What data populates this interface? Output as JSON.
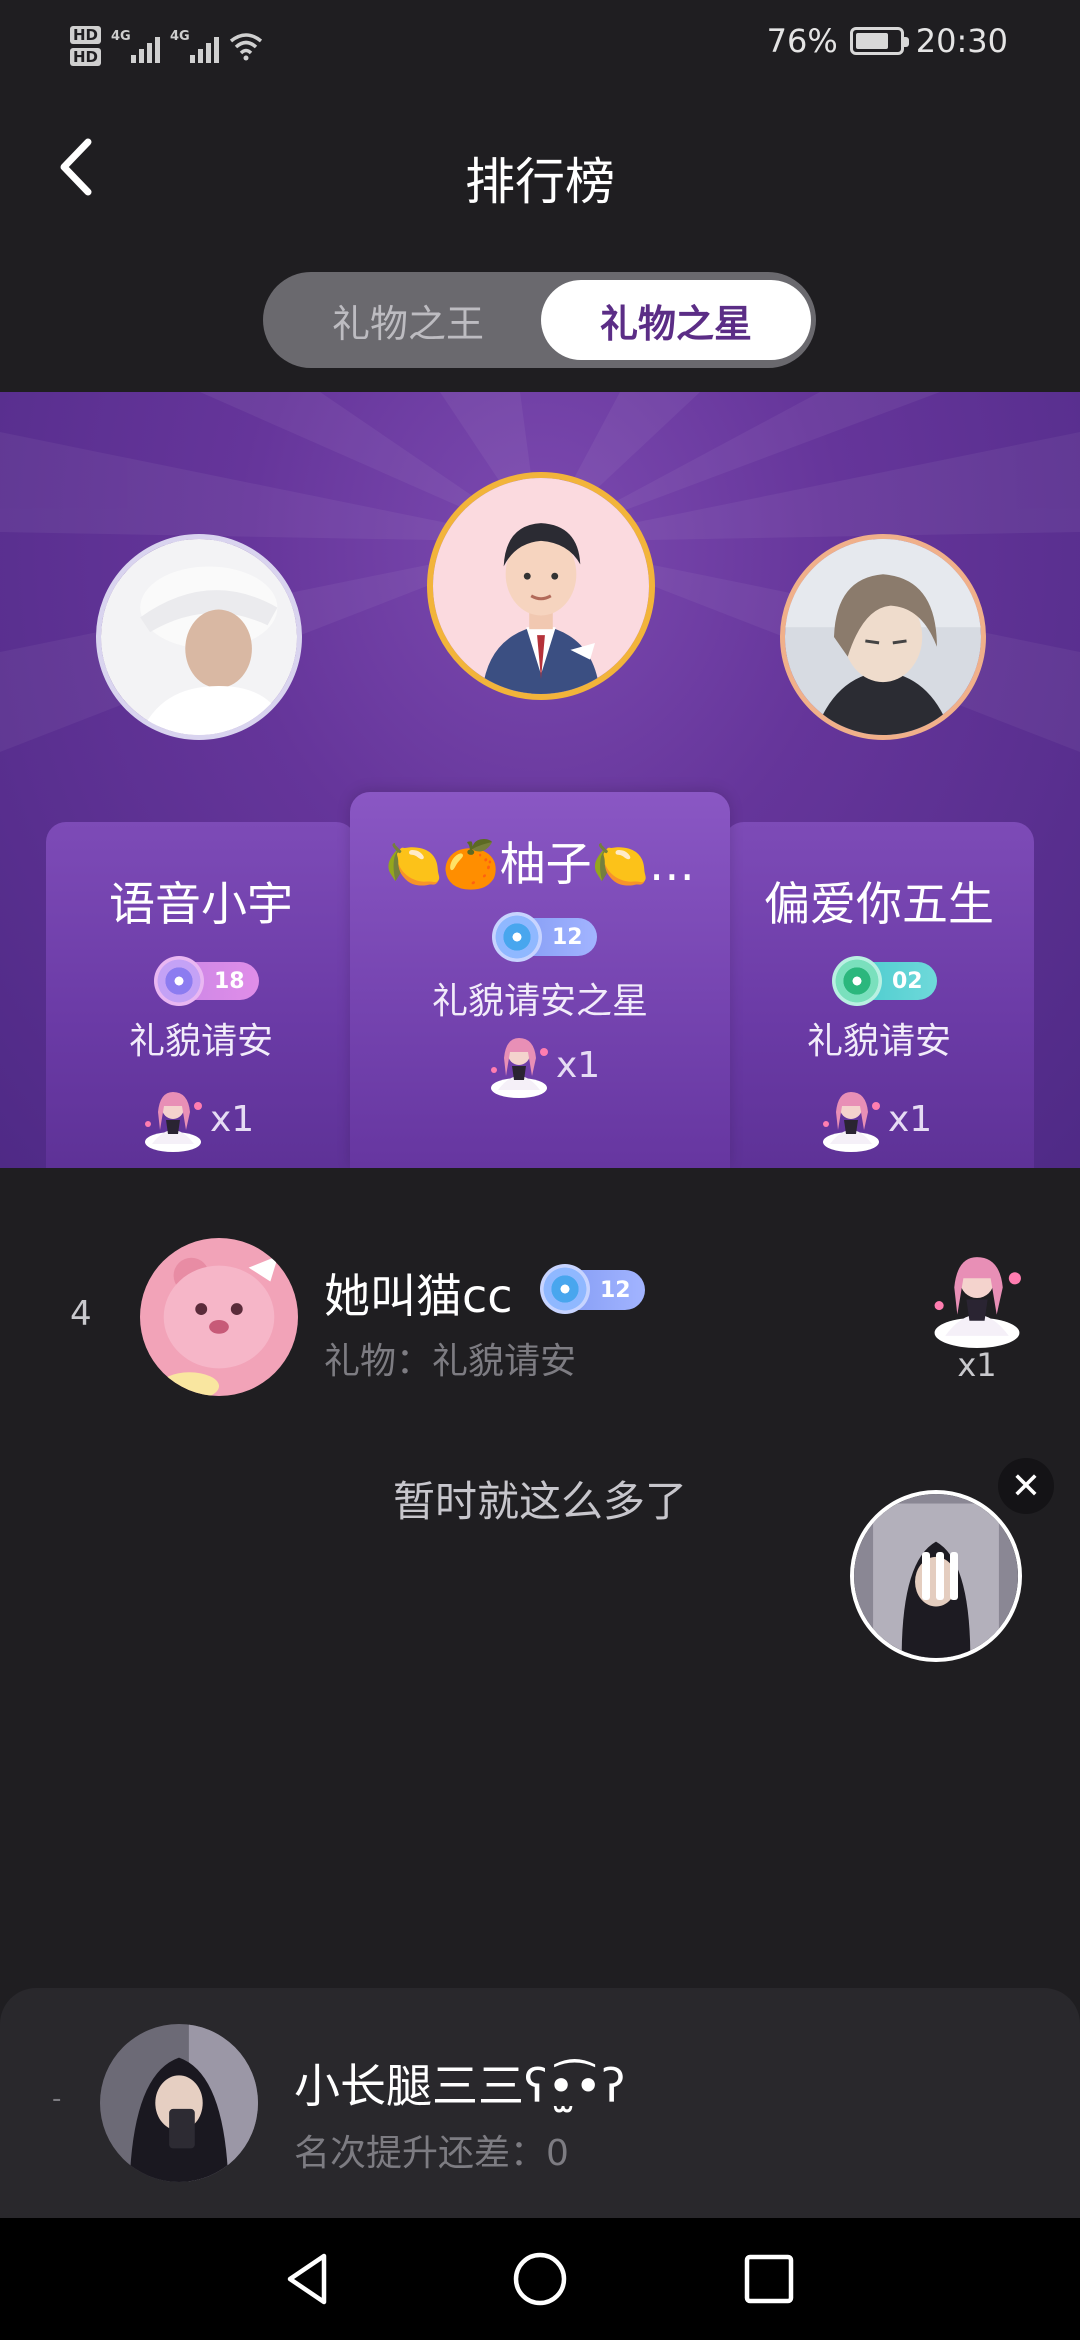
{
  "status_bar": {
    "hd1": "HD",
    "hd2": "HD",
    "net1": "4G",
    "net2": "4G",
    "battery": "76%",
    "time": "20:30",
    "battery_level": 0.76
  },
  "header": {
    "title": "排行榜",
    "back_icon": "chevron-left-icon"
  },
  "tabs": [
    {
      "label": "礼物之王",
      "selected": false
    },
    {
      "label": "礼物之星",
      "selected": true
    }
  ],
  "podium": {
    "first": {
      "name": "🍋🍊柚子🍋…",
      "level": "12",
      "gift": "礼貌请安之星",
      "count": "x1"
    },
    "second": {
      "name": "语音小宇",
      "level": "18",
      "gift": "礼貌请安",
      "count": "x1"
    },
    "third": {
      "name": "偏爱你五生",
      "level": "02",
      "gift": "礼貌请安",
      "count": "x1"
    }
  },
  "list": [
    {
      "rank": "4",
      "name": "她叫猫cc",
      "level": "12",
      "gift_line": "礼物：礼貌请安",
      "count": "x1"
    }
  ],
  "end_note": "暂时就这么多了",
  "float_player": {
    "close": "✕"
  },
  "self": {
    "rank": "-",
    "name": "小长腿三三ʕ•̫͡•ʔ",
    "sub": "名次提升还差：0"
  },
  "colors": {
    "background": "#1f1e21",
    "podium": "#65359a",
    "accent": "#5b2d86",
    "gold_ring": "#f2b43a"
  }
}
